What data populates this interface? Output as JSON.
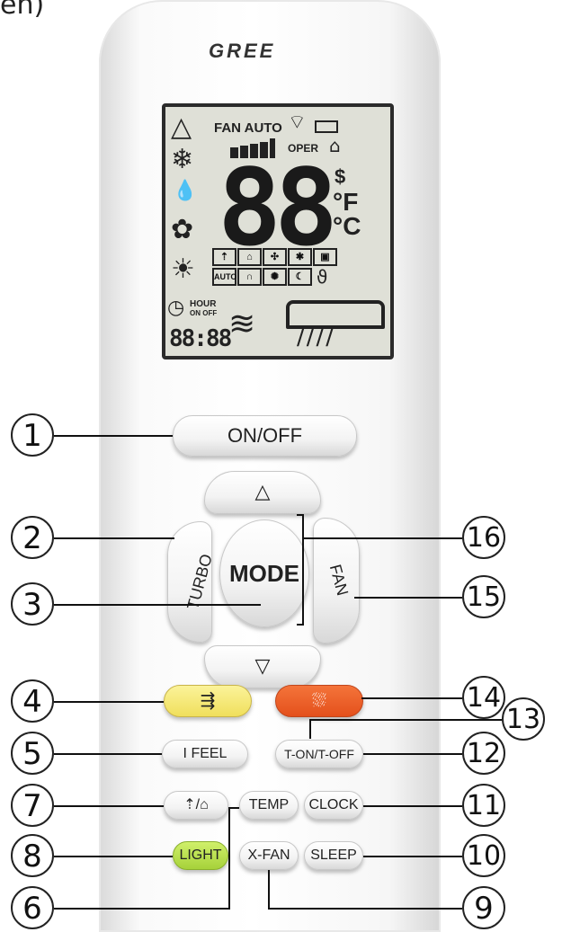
{
  "top_label": "en)",
  "brand": "GREE",
  "lcd": {
    "fan_auto": "FAN AUTO",
    "oper": "OPER",
    "temp_digits": "88",
    "dollar": "$",
    "fahrenheit": "°F",
    "celsius": "°C",
    "hour": "HOUR",
    "on_off": "ON OFF",
    "timer_digits": "88:88",
    "auto": "AUTO"
  },
  "buttons": {
    "on_off": "ON/OFF",
    "up": "△",
    "down": "▽",
    "turbo": "TURBO",
    "mode": "MODE",
    "fan": "FAN",
    "swing_ud": "⇶",
    "swing_lr": "⛆",
    "i_feel": "I FEEL",
    "t_on_t_off": "T-ON/T-OFF",
    "health_air": "⇡/⌂",
    "temp": "TEMP",
    "clock": "CLOCK",
    "light": "LIGHT",
    "x_fan": "X-FAN",
    "sleep": "SLEEP"
  },
  "callouts": [
    "1",
    "2",
    "3",
    "4",
    "5",
    "7",
    "8",
    "6",
    "16",
    "15",
    "14",
    "13",
    "12",
    "11",
    "10",
    "9"
  ],
  "colors": {
    "yellow_button": "#f3e36a",
    "orange_button": "#ef5a24",
    "green_button": "#b6e04a"
  }
}
